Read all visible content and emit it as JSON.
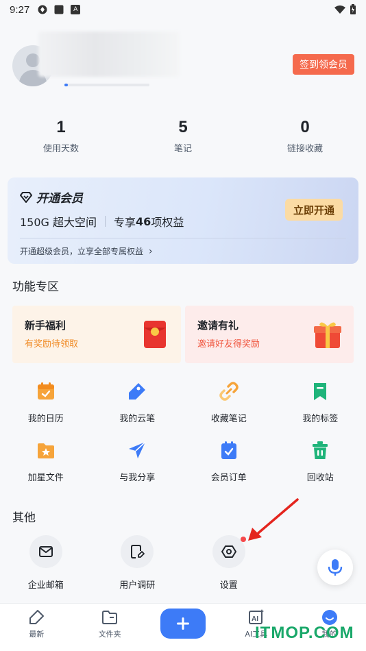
{
  "status_bar": {
    "time": "9:27",
    "sim_icon_letter": "A"
  },
  "profile": {
    "sign_button": "签到领会员",
    "level_progress": 0.04
  },
  "stats": [
    {
      "value": "1",
      "label": "使用天数"
    },
    {
      "value": "5",
      "label": "笔记"
    },
    {
      "value": "0",
      "label": "链接收藏"
    }
  ],
  "vip": {
    "title": "开通会员",
    "feature_space": "150G 超大空间",
    "feature_rights_prefix": "专享",
    "feature_rights_count": "46",
    "feature_rights_suffix": "项权益",
    "open_button": "立即开通",
    "link_text": "开通超级会员，立享全部专属权益",
    "link_chevron": "›"
  },
  "features": {
    "title": "功能专区",
    "promos": [
      {
        "title": "新手福利",
        "subtitle": "有奖励待领取",
        "icon": "red-envelope-icon",
        "bg": "#fdf3e8",
        "sub_color": "#f08a24"
      },
      {
        "title": "邀请有礼",
        "subtitle": "邀请好友得奖励",
        "icon": "gift-box-icon",
        "bg": "#fdeceb",
        "sub_color": "#f0563f"
      }
    ],
    "grid_row1": [
      {
        "label": "我的日历",
        "icon": "calendar-icon"
      },
      {
        "label": "我的云笔",
        "icon": "pen-tag-icon"
      },
      {
        "label": "收藏笔记",
        "icon": "link-icon"
      },
      {
        "label": "我的标签",
        "icon": "bookmark-icon"
      }
    ],
    "grid_row2": [
      {
        "label": "加星文件",
        "icon": "star-folder-icon"
      },
      {
        "label": "与我分享",
        "icon": "send-icon"
      },
      {
        "label": "会员订单",
        "icon": "order-check-icon"
      },
      {
        "label": "回收站",
        "icon": "trash-icon"
      }
    ]
  },
  "other": {
    "title": "其他",
    "items": [
      {
        "label": "企业邮箱",
        "icon": "mail-icon"
      },
      {
        "label": "用户调研",
        "icon": "survey-icon"
      },
      {
        "label": "设置",
        "icon": "settings-hexagon-icon"
      }
    ]
  },
  "bottom_nav": [
    {
      "label": "最新",
      "icon": "recent-icon"
    },
    {
      "label": "文件夹",
      "icon": "folder-icon"
    },
    {
      "label": "",
      "icon": "plus-icon"
    },
    {
      "label": "AI工具",
      "icon": "ai-icon"
    },
    {
      "label": "我的",
      "icon": "profile-face-icon"
    }
  ],
  "watermark": "ITMOP.COM",
  "colors": {
    "accent": "#3d7bf7",
    "sign_button": "#f56a4d",
    "vip_button": "#fbdba4"
  }
}
